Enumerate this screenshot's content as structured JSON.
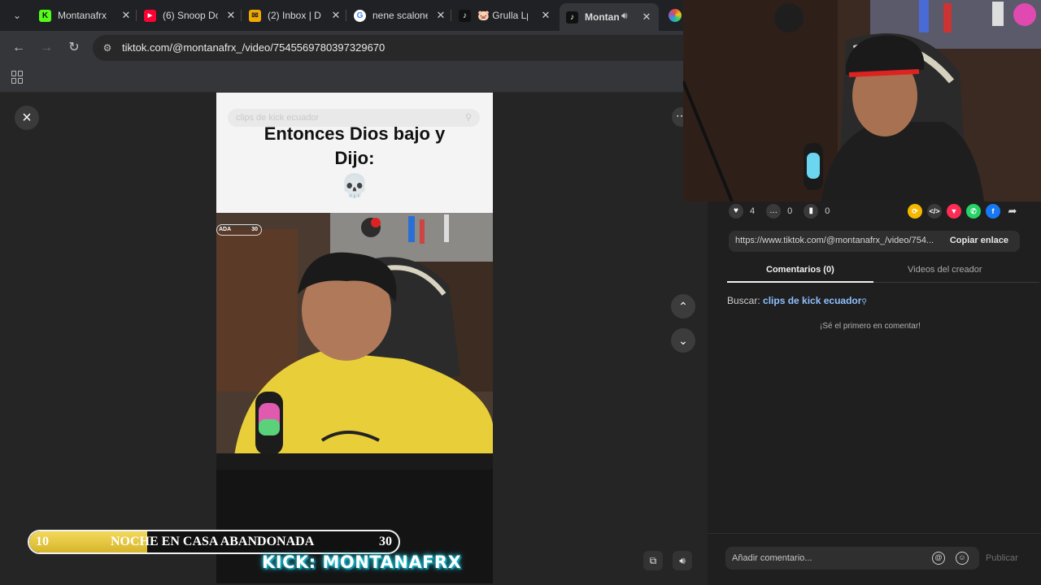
{
  "browser": {
    "tabs": [
      {
        "title": "Montanafrx",
        "favicon": "kick-icon",
        "color": "#53fc18",
        "glyph": "K"
      },
      {
        "title": "(6) Snoop Do",
        "favicon": "youtube-icon",
        "color": "#ff0033",
        "glyph": "▶"
      },
      {
        "title": "(2) Inbox | D",
        "favicon": "inbox-icon",
        "color": "#f2a900",
        "glyph": "✉"
      },
      {
        "title": "nene scalone",
        "favicon": "google-icon",
        "color": "#ffffff",
        "glyph": "G"
      },
      {
        "title": "🐷 Grulla Lp",
        "favicon": "tiktok-icon",
        "color": "#111111",
        "glyph": "♪"
      },
      {
        "title": "Montan",
        "favicon": "tiktok-icon",
        "color": "#111111",
        "glyph": "♪"
      }
    ],
    "url": "tiktok.com/@montanafrx_/video/7545569780397329670"
  },
  "video": {
    "search_ghost": "clips de kick ecuador",
    "caption_line1": "Entonces Dios bajo y",
    "caption_line2": "Dijo:",
    "skull": "💀",
    "mini_overlay_left": "ADA",
    "mini_overlay_right": "30"
  },
  "overlay": {
    "left_number": "10",
    "title": "NOCHE EN CASA ABANDONADA",
    "right_number": "30",
    "progress_fraction": 0.32,
    "kick_text": "KICK: MONTANAFRX"
  },
  "panel": {
    "likes": "4",
    "comments": "0",
    "saves": "0",
    "share_colors": [
      "#f5b800",
      "#3a3a3a",
      "#fe2c55",
      "#25d366",
      "#1877f2"
    ],
    "link": "https://www.tiktok.com/@montanafrx_/video/754...",
    "copy_label": "Copiar enlace",
    "tab_comments": "Comentarios (0)",
    "tab_videos": "Videos del creador",
    "search_prefix": "Buscar:",
    "search_term": "clips de kick ecuador",
    "empty_comments": "¡Sé el primero en comentar!",
    "comment_placeholder": "Añadir comentario...",
    "publish_label": "Publicar"
  }
}
